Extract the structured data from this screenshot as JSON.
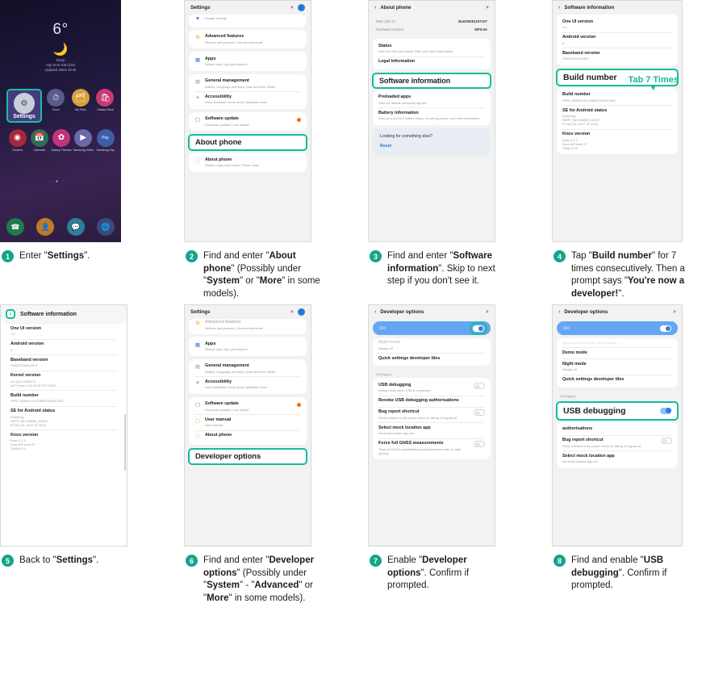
{
  "accent": "#12bd9b",
  "step_badge_color": "#12a58a",
  "steps": [
    {
      "number": "1",
      "caption_parts": [
        {
          "t": "Enter \"",
          "b": false
        },
        {
          "t": "Settings",
          "b": true
        },
        {
          "t": "\".",
          "b": false
        }
      ]
    },
    {
      "number": "2",
      "caption_parts": [
        {
          "t": "Find and enter \"",
          "b": false
        },
        {
          "t": "About phone",
          "b": true
        },
        {
          "t": "\" (Possibly under \"",
          "b": false
        },
        {
          "t": "System",
          "b": true
        },
        {
          "t": "\" or \"",
          "b": false
        },
        {
          "t": "More",
          "b": true
        },
        {
          "t": "\" in some models).",
          "b": false
        }
      ]
    },
    {
      "number": "3",
      "caption_parts": [
        {
          "t": "Find and enter \"",
          "b": false
        },
        {
          "t": "Software information",
          "b": true
        },
        {
          "t": "\". Skip to next step if you don't see it.",
          "b": false
        }
      ]
    },
    {
      "number": "4",
      "caption_parts": [
        {
          "t": "Tap \"",
          "b": false
        },
        {
          "t": "Build number",
          "b": true
        },
        {
          "t": "\" for 7 times consecutively. Then a prompt says \"",
          "b": false
        },
        {
          "t": "You're now a developer!",
          "b": true
        },
        {
          "t": "\".",
          "b": false
        }
      ]
    },
    {
      "number": "5",
      "caption_parts": [
        {
          "t": "Back to \"",
          "b": false
        },
        {
          "t": "Settings",
          "b": true
        },
        {
          "t": "\".",
          "b": false
        }
      ]
    },
    {
      "number": "6",
      "caption_parts": [
        {
          "t": "Find and enter \"",
          "b": false
        },
        {
          "t": "Developer options",
          "b": true
        },
        {
          "t": "\" (Possibly under \"",
          "b": false
        },
        {
          "t": "System",
          "b": true
        },
        {
          "t": "\" - \"",
          "b": false
        },
        {
          "t": "Advanced",
          "b": true
        },
        {
          "t": "\" or \"",
          "b": false
        },
        {
          "t": "More",
          "b": true
        },
        {
          "t": "\" in some models).",
          "b": false
        }
      ]
    },
    {
      "number": "7",
      "caption_parts": [
        {
          "t": "Enable \"",
          "b": false
        },
        {
          "t": "Developer options",
          "b": true
        },
        {
          "t": "\". Confirm if prompted.",
          "b": false
        }
      ]
    },
    {
      "number": "8",
      "caption_parts": [
        {
          "t": "Find and enable \"",
          "b": false
        },
        {
          "t": "USB debugging",
          "b": true
        },
        {
          "t": "\". Confirm if prompted.",
          "b": false
        }
      ]
    }
  ],
  "panel1": {
    "temperature": "6°",
    "weather_icon": "🌙",
    "condition": "Sharp",
    "location_line": "AQI 10·B 108 (104)",
    "updated_line": "Updated 26/02 19:46",
    "apps_row1": [
      {
        "label": "Settings",
        "icon": "⚙",
        "bg": "#c7cfdb",
        "fg": "#3b4a5e",
        "selected": true
      },
      {
        "label": "Clock",
        "icon": "⏱",
        "bg": "#5c5a8a",
        "fg": "#ffffff",
        "selected": false
      },
      {
        "label": "My Files",
        "icon": "🗂",
        "bg": "#d8a23a",
        "fg": "#ffffff",
        "selected": false
      },
      {
        "label": "Galaxy Store",
        "icon": "🛍",
        "bg": "#c93a74",
        "fg": "#ffffff",
        "selected": false
      }
    ],
    "apps_row2": [
      {
        "label": "Camera",
        "icon": "📷",
        "bg": "#a8273c",
        "fg": "#ffffff"
      },
      {
        "label": "Calendar",
        "icon": "📅",
        "bg": "#2f6e54",
        "fg": "#ffffff"
      },
      {
        "label": "Galaxy Themes",
        "icon": "🌸",
        "bg": "#c2347a",
        "fg": "#ffffff"
      },
      {
        "label": "Samsung Video",
        "icon": "▶",
        "bg": "#6a6aa8",
        "fg": "#ffffff"
      },
      {
        "label": "Samsung Pay",
        "icon": "Pay",
        "bg": "#3d5fa8",
        "fg": "#ffffff"
      }
    ],
    "page_dots": "· ● · ·",
    "dock": [
      {
        "icon": "📞",
        "bg": "#1f7a4d"
      },
      {
        "icon": "👤",
        "bg": "#c07a22"
      },
      {
        "icon": "💬",
        "bg": "#2b7f9e"
      },
      {
        "icon": "🌐",
        "bg": "#3b4a7d"
      }
    ]
  },
  "panel2": {
    "header_title": "Settings",
    "search_icon": "⌕",
    "account_icon": "👤",
    "partial_top_item": "Google settings",
    "items": [
      {
        "title": "Advanced features",
        "sub": "Motions and gestures, One-handed mode",
        "icon": "⚙",
        "icon_color": "#f5a623"
      },
      {
        "title": "Apps",
        "sub": "Default apps, App permissions",
        "icon": "▒",
        "icon_color": "#3b7ddd"
      },
      {
        "title": "General management",
        "sub": "Battery, Language and input, Date and time, Reset",
        "icon": "▦",
        "icon_color": "#9fb6cc"
      },
      {
        "title": "Accessibility",
        "sub": "Voice Assistant, Mono audio, Assistant menu",
        "icon": "✦",
        "icon_color": "#5cb85c"
      },
      {
        "title": "Software update",
        "sub": "Download updates, Last update",
        "icon": "↻",
        "icon_color": "#3b7ddd",
        "badge": true
      }
    ],
    "highlight": "About phone",
    "bottom_item": {
      "title": "About phone",
      "sub": "Status, Legal information, Phone name",
      "icon": "ⓘ"
    }
  },
  "panel3": {
    "header_title": "About phone",
    "search_icon": "⌕",
    "back_icon": "‹",
    "kv": [
      {
        "k": "IMEI (slot 2)",
        "v": "354259051197107"
      },
      {
        "k": "Hardware version",
        "v": "MP0.9A"
      }
    ],
    "items": [
      {
        "title": "Status",
        "sub": "View the SIM card status, IMEI, and other information."
      },
      {
        "title": "Legal information",
        "sub": ""
      }
    ],
    "highlight": "Software information",
    "items_after": [
      {
        "title": "Preloaded apps",
        "sub": "View the default preloaded app list."
      },
      {
        "title": "Battery information",
        "sub": "View your phone's battery status, remaining power, and other information."
      }
    ],
    "footer_title": "Looking for something else?",
    "footer_link": "Reset"
  },
  "panel4": {
    "header_title": "Software information",
    "back_icon": "‹",
    "tab_hint": "Tab 7 Times",
    "tab_arrow": "▼",
    "items_before": [
      {
        "title": "One UI version",
        "sub": "1.0"
      },
      {
        "title": "Android version",
        "sub": "9"
      },
      {
        "title": "Baseband version",
        "sub": "G960ZCDSACSK2"
      }
    ],
    "highlight": "Build number",
    "items_after": [
      {
        "title": "Build number",
        "sub": "PPR1.180610.011-G960ZCDSACSK2"
      },
      {
        "title": "SE for Android status",
        "sub": "Enforcing\nSEPF_SM-G960B_9.0012\nFri Nov 01 14:47:47 2019"
      },
      {
        "title": "Knox version",
        "sub": "Knox 3.2.1\nKnox API level 27\nTIMA 4.0.0"
      }
    ]
  },
  "panel5": {
    "header_title": "Software information",
    "back_icon": "‹",
    "items": [
      {
        "title": "One UI version",
        "sub": "1.0"
      },
      {
        "title": "Android version",
        "sub": "9"
      },
      {
        "title": "Baseband version",
        "sub": "G960ZCDSACSK2"
      },
      {
        "title": "Kernel version",
        "sub": "4.9.112-17695175\n#2 Fri Nov 1 15:21:30 KST 2019"
      },
      {
        "title": "Build number",
        "sub": "PPR1.180610.011-G960ZCDSACSK2"
      },
      {
        "title": "SE for Android status",
        "sub": "Enforcing\nSEPF_SM-G960B_9.0012\nFri Nov 01 14:47:47 2019"
      },
      {
        "title": "Knox version",
        "sub": "Knox 3.2.1\nKnox API level 27\nTIMA 4.0.0"
      }
    ]
  },
  "panel6": {
    "header_title": "Settings",
    "search_icon": "⌕",
    "account_icon": "👤",
    "partial_top_item": {
      "title": "Advanced features",
      "sub": "Motions and gestures, One-handed mode",
      "icon": "⚙",
      "icon_color": "#f5a623"
    },
    "items": [
      {
        "title": "Apps",
        "sub": "Default apps, App permissions",
        "icon": "▒",
        "icon_color": "#3b7ddd"
      },
      {
        "title": "General management",
        "sub": "Battery, Language and input, Date and time, Reset",
        "icon": "▦",
        "icon_color": "#9fb6cc"
      },
      {
        "title": "Accessibility",
        "sub": "Voice Assistant, Mono audio, Assistant menu",
        "icon": "✦",
        "icon_color": "#5cb85c"
      },
      {
        "title": "Software update",
        "sub": "Download updates, Last update",
        "icon": "↻",
        "icon_color": "#3b7ddd",
        "badge": true
      },
      {
        "title": "User manual",
        "sub": "User manual",
        "icon": "📒",
        "icon_color": "#f5a623"
      },
      {
        "title": "About phone",
        "sub": "",
        "icon": "ⓘ",
        "icon_color": "#b0b0b0"
      }
    ],
    "highlight": "Developer options"
  },
  "panel7": {
    "header_title": "Developer options",
    "back_icon": "‹",
    "search_icon": "⌕",
    "toggle_label": "On",
    "toggle_state": "on",
    "partial_top": {
      "title": "Night mode",
      "sub": "Always off"
    },
    "items_before": [
      {
        "title": "Quick settings developer tiles",
        "sub": ""
      }
    ],
    "section_label": "Debugging",
    "items": [
      {
        "title": "USB debugging",
        "sub": "Debug mode when USB is connected",
        "toggle": "off"
      },
      {
        "title": "Revoke USB debugging authorisations",
        "sub": ""
      },
      {
        "title": "Bug report shortcut",
        "sub": "Show a button in the power menu for taking a bug report",
        "toggle": "off"
      },
      {
        "title": "Select mock location app",
        "sub": "No mock location app set"
      },
      {
        "title": "Force full GNSS measurements",
        "sub": "Track all GNSS constellations and frequencies with no duty cycling.",
        "toggle": "off"
      }
    ]
  },
  "panel8": {
    "header_title": "Developer options",
    "back_icon": "‹",
    "search_icon": "⌕",
    "toggle_label": "On",
    "toggle_state": "on",
    "partial_top": {
      "title": "Apply updates when the phone restarts",
      "sub": ""
    },
    "items_before": [
      {
        "title": "Demo mode",
        "sub": ""
      },
      {
        "title": "Night mode",
        "sub": "Always off"
      },
      {
        "title": "Quick settings developer tiles",
        "sub": ""
      }
    ],
    "section_label": "Debugging",
    "highlight": "USB debugging",
    "highlight_toggle": "on",
    "items_after": [
      {
        "title": "authorisations",
        "sub": ""
      },
      {
        "title": "Bug report shortcut",
        "sub": "Show a button in the power menu for taking a bug report",
        "toggle": "off"
      },
      {
        "title": "Select mock location app",
        "sub": "No mock location app set"
      }
    ]
  }
}
